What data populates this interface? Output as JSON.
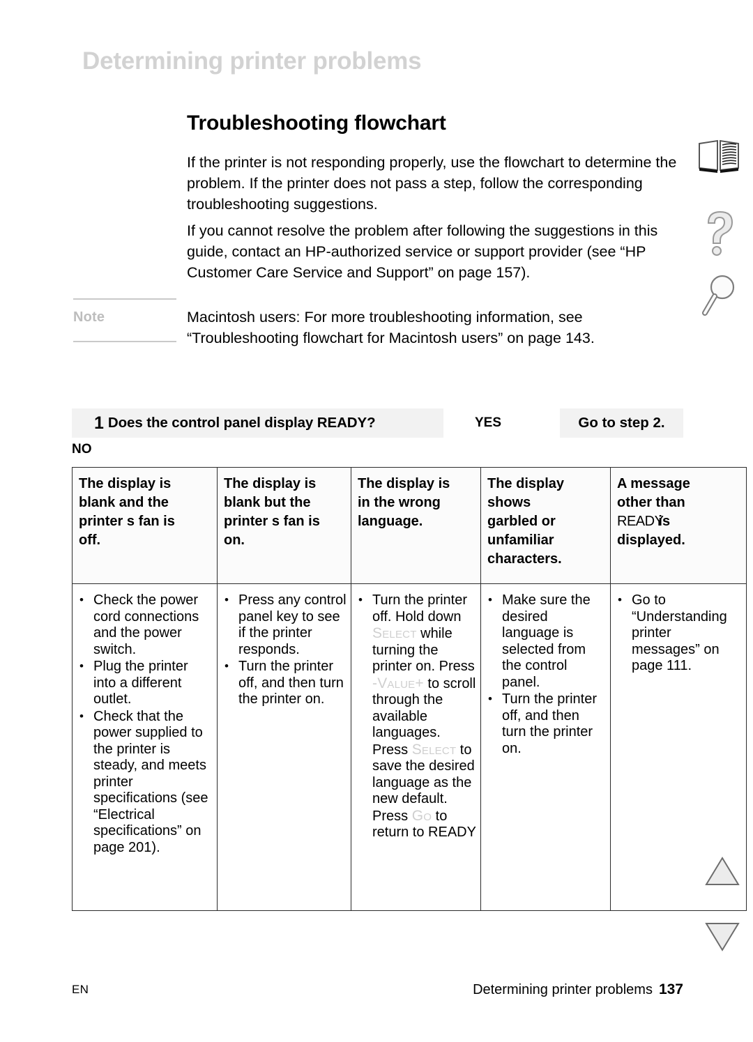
{
  "running_header": "Determining printer problems",
  "section": {
    "heading": "Troubleshooting flowchart",
    "paragraph_1": "If the printer is not responding properly, use the flowchart to determine the problem. If the printer does not pass a step, follow the corresponding troubleshooting suggestions.",
    "paragraph_2": "If you cannot resolve the problem after following the suggestions in this guide, contact an HP-authorized service or support provider (see “HP Customer Care Service and Support” on page 157)."
  },
  "note": {
    "label": "Note",
    "text": "Macintosh users: For more troubleshooting information, see “Troubleshooting flowchart for Macintosh users” on page 143."
  },
  "step": {
    "number": "1",
    "question": "Does the control panel display READY?",
    "yes_label": "YES",
    "yes_action": "Go to step 2.",
    "no_label": "NO"
  },
  "table": {
    "headers": [
      {
        "line1": "The display is",
        "line2": "blank and the",
        "line3": "printer s fan is",
        "line4": "off."
      },
      {
        "line1": "The display is",
        "line2": "blank but the",
        "line3": "printer s fan is",
        "line4": "on."
      },
      {
        "line1": "The display is",
        "line2": "in the wrong",
        "line3": "language."
      },
      {
        "line1": "The display",
        "line2": "shows",
        "line3": "garbled or",
        "line4": "unfamiliar",
        "line5": "characters."
      },
      {
        "line1": "A message",
        "line2": "other than",
        "line3_key": "READY",
        "line3_rest": "is",
        "line4": "displayed."
      }
    ],
    "columns": [
      {
        "bullets": [
          "Check the power cord connections and the power switch.",
          "Plug the printer into a different outlet.",
          "Check that the power supplied to the printer is steady, and meets printer specifications (see “Electrical specifications” on page 201)."
        ]
      },
      {
        "bullets": [
          "Press any control panel key to see if the printer responds.",
          "Turn the printer off, and then turn the printer on."
        ]
      },
      {
        "rich_bullet": {
          "t1": "Turn the printer off. Hold down ",
          "k1": "Select",
          "t2": " while turning the printer on. Press ",
          "k2": "-Value+",
          "t3": " to scroll through the available languages. Press ",
          "k3": "Select",
          "t4": " to save the desired language as the new default. Press ",
          "k4": "Go",
          "t5": " to return to ",
          "t6": "READY"
        }
      },
      {
        "bullets": [
          "Make sure the desired language is selected from the control panel.",
          "Turn the printer off, and then turn the printer on."
        ]
      },
      {
        "bullets": [
          "Go to “Understanding printer messages” on page 111."
        ]
      }
    ]
  },
  "footer": {
    "language": "EN",
    "title": "Determining printer problems",
    "page": "137"
  },
  "colors": {
    "running_header": "#d2d2d2",
    "note_label": "#bdbdbd",
    "shaded_box": "#f2f2f2",
    "key_token": "#cfcfcf",
    "table_border": "#2b2b2b"
  },
  "margin_icons": [
    "book-icon",
    "question-mark-icon",
    "magnifier-icon",
    "triangle-up-icon",
    "triangle-down-icon"
  ]
}
